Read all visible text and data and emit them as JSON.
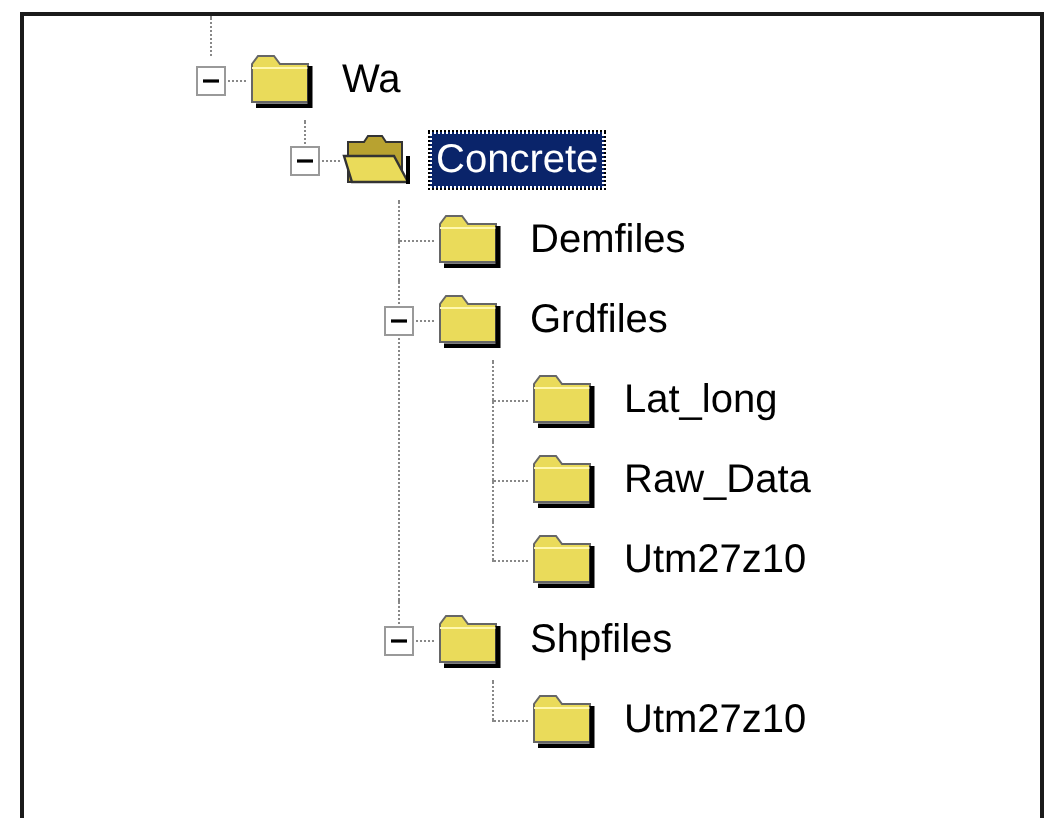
{
  "tree": [
    {
      "label": "Wa",
      "selected": false,
      "expanded": true,
      "children": [
        {
          "label": "Concrete",
          "selected": true,
          "expanded": true,
          "children": [
            {
              "label": "Demfiles",
              "selected": false
            },
            {
              "label": "Grdfiles",
              "selected": false,
              "expanded": true,
              "children": [
                {
                  "label": "Lat_long",
                  "selected": false
                },
                {
                  "label": "Raw_Data",
                  "selected": false
                },
                {
                  "label": "Utm27z10",
                  "selected": false
                }
              ]
            },
            {
              "label": "Shpfiles",
              "selected": false,
              "expanded": true,
              "children": [
                {
                  "label": "Utm27z10",
                  "selected": false
                }
              ]
            }
          ]
        }
      ]
    }
  ]
}
